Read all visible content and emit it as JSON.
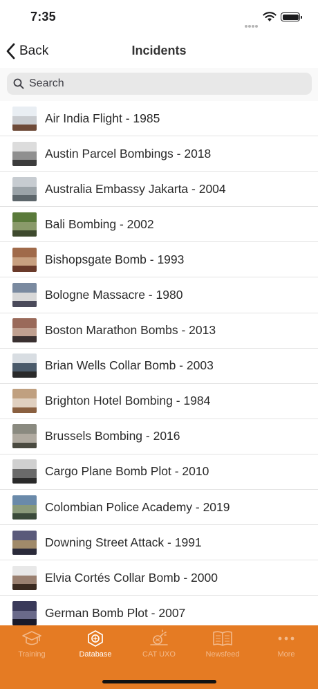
{
  "status": {
    "time": "7:35"
  },
  "nav": {
    "back_label": "Back",
    "title": "Incidents"
  },
  "search": {
    "placeholder": "Search"
  },
  "incidents": [
    {
      "label": "Air India Flight - 1985",
      "thumb_colors": [
        "#e9eef3",
        "#c9ccd0",
        "#6e4a38"
      ]
    },
    {
      "label": "Austin Parcel Bombings - 2018",
      "thumb_colors": [
        "#dcdcdc",
        "#8f8f8f",
        "#3c3c3c"
      ]
    },
    {
      "label": "Australia Embassy Jakarta - 2004",
      "thumb_colors": [
        "#c7ccd1",
        "#9ba3a8",
        "#5d666b"
      ]
    },
    {
      "label": "Bali Bombing - 2002",
      "thumb_colors": [
        "#5a7a3a",
        "#8a9a6a",
        "#3e4a2e"
      ]
    },
    {
      "label": "Bishopsgate Bomb - 1993",
      "thumb_colors": [
        "#a06a4a",
        "#c8a080",
        "#6a3a2a"
      ]
    },
    {
      "label": "Bologne Massacre - 1980",
      "thumb_colors": [
        "#7a8aa0",
        "#d8d8d8",
        "#4a4a5a"
      ]
    },
    {
      "label": "Boston Marathon Bombs - 2013",
      "thumb_colors": [
        "#9a6a5a",
        "#c0a090",
        "#3a3030"
      ]
    },
    {
      "label": "Brian Wells Collar Bomb - 2003",
      "thumb_colors": [
        "#d8dde2",
        "#4a5a6a",
        "#2a2a2a"
      ]
    },
    {
      "label": "Brighton Hotel Bombing - 1984",
      "thumb_colors": [
        "#c0a080",
        "#e0d0c0",
        "#8a6040"
      ]
    },
    {
      "label": "Brussels Bombing - 2016",
      "thumb_colors": [
        "#8a8a80",
        "#b0aaa0",
        "#4a4a40"
      ]
    },
    {
      "label": "Cargo Plane Bomb Plot - 2010",
      "thumb_colors": [
        "#d0d0d0",
        "#6a6a6a",
        "#2a2a2a"
      ]
    },
    {
      "label": "Colombian Police Academy - 2019",
      "thumb_colors": [
        "#6a8aaa",
        "#8a9a7a",
        "#3a4a3a"
      ]
    },
    {
      "label": "Downing Street Attack - 1991",
      "thumb_colors": [
        "#5a5a7a",
        "#a08a6a",
        "#2a2a3a"
      ]
    },
    {
      "label": "Elvia Cortés Collar Bomb - 2000",
      "thumb_colors": [
        "#e8e8e8",
        "#9a8070",
        "#3a2a20"
      ]
    },
    {
      "label": "German Bomb Plot - 2007",
      "thumb_colors": [
        "#3a3a5a",
        "#6a6a8a",
        "#1a1a2a"
      ]
    }
  ],
  "tabs": [
    {
      "label": "Training",
      "icon": "graduation-cap-icon",
      "active": false
    },
    {
      "label": "Database",
      "icon": "database-icon",
      "active": true
    },
    {
      "label": "CAT UXO",
      "icon": "explosion-icon",
      "active": false
    },
    {
      "label": "Newsfeed",
      "icon": "book-icon",
      "active": false
    },
    {
      "label": "More",
      "icon": "more-dots-icon",
      "active": false
    }
  ],
  "colors": {
    "accent": "#e57b23",
    "tab_inactive": "#f3b98a",
    "tab_active": "#ffffff"
  }
}
